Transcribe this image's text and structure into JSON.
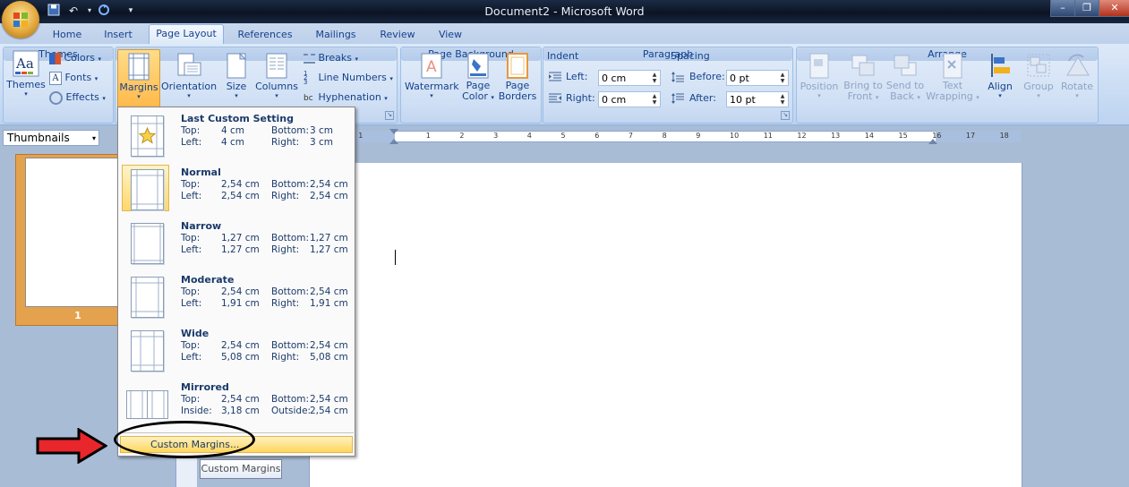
{
  "window": {
    "title": "Document2 - Microsoft Word",
    "minimize": "–",
    "restore": "❐",
    "close": "✕"
  },
  "tabs": [
    {
      "label": "Home"
    },
    {
      "label": "Insert"
    },
    {
      "label": "Page Layout"
    },
    {
      "label": "References"
    },
    {
      "label": "Mailings"
    },
    {
      "label": "Review"
    },
    {
      "label": "View"
    }
  ],
  "themes_group": {
    "label": "Themes",
    "themes": "Themes",
    "colors": "Colors",
    "fonts": "Fonts",
    "effects": "Effects"
  },
  "page_setup": {
    "margins": "Margins",
    "orientation": "Orientation",
    "size": "Size",
    "columns": "Columns",
    "breaks": "Breaks",
    "line_numbers": "Line Numbers",
    "hyphenation": "Hyphenation"
  },
  "page_background": {
    "label": "Page Background",
    "watermark": "Watermark",
    "page_color_1": "Page",
    "page_color_2": "Color",
    "page_borders_1": "Page",
    "page_borders_2": "Borders"
  },
  "paragraph": {
    "label": "Paragraph",
    "indent": "Indent",
    "spacing": "Spacing",
    "left_label": "Left:",
    "left_value": "0 cm",
    "right_label": "Right:",
    "right_value": "0 cm",
    "before_label": "Before:",
    "before_value": "0 pt",
    "after_label": "After:",
    "after_value": "10 pt"
  },
  "arrange": {
    "label": "Arrange",
    "position": "Position",
    "bring_1": "Bring to",
    "bring_2": "Front",
    "send_1": "Send to",
    "send_2": "Back",
    "text_1": "Text",
    "text_2": "Wrapping",
    "align": "Align",
    "group": "Group",
    "rotate": "Rotate"
  },
  "thumbnails": {
    "select_value": "Thumbnails",
    "page_number": "1"
  },
  "ruler_ticks": [
    "1",
    "1",
    "2",
    "3",
    "4",
    "5",
    "6",
    "7",
    "8",
    "9",
    "10",
    "11",
    "12",
    "13",
    "14",
    "15",
    "16",
    "17",
    "18"
  ],
  "margins_menu": [
    {
      "name": "Last Custom Setting",
      "r1": [
        "Top:",
        "4 cm",
        "Bottom:",
        "3 cm"
      ],
      "r2": [
        "Left:",
        "4 cm",
        "Right:",
        "3 cm"
      ]
    },
    {
      "name": "Normal",
      "r1": [
        "Top:",
        "2,54 cm",
        "Bottom:",
        "2,54 cm"
      ],
      "r2": [
        "Left:",
        "2,54 cm",
        "Right:",
        "2,54 cm"
      ]
    },
    {
      "name": "Narrow",
      "r1": [
        "Top:",
        "1,27 cm",
        "Bottom:",
        "1,27 cm"
      ],
      "r2": [
        "Left:",
        "1,27 cm",
        "Right:",
        "1,27 cm"
      ]
    },
    {
      "name": "Moderate",
      "r1": [
        "Top:",
        "2,54 cm",
        "Bottom:",
        "2,54 cm"
      ],
      "r2": [
        "Left:",
        "1,91 cm",
        "Right:",
        "1,91 cm"
      ]
    },
    {
      "name": "Wide",
      "r1": [
        "Top:",
        "2,54 cm",
        "Bottom:",
        "2,54 cm"
      ],
      "r2": [
        "Left:",
        "5,08 cm",
        "Right:",
        "5,08 cm"
      ]
    },
    {
      "name": "Mirrored",
      "r1": [
        "Top:",
        "2,54 cm",
        "Bottom:",
        "2,54 cm"
      ],
      "r2": [
        "Inside:",
        "3,18 cm",
        "Outside:",
        "2,54 cm"
      ]
    }
  ],
  "custom_margins": "Custom Margins...",
  "tooltip": "Custom Margins",
  "colors": {
    "accent_arrow": "#e8262b",
    "highlight": "#ffd86b"
  }
}
